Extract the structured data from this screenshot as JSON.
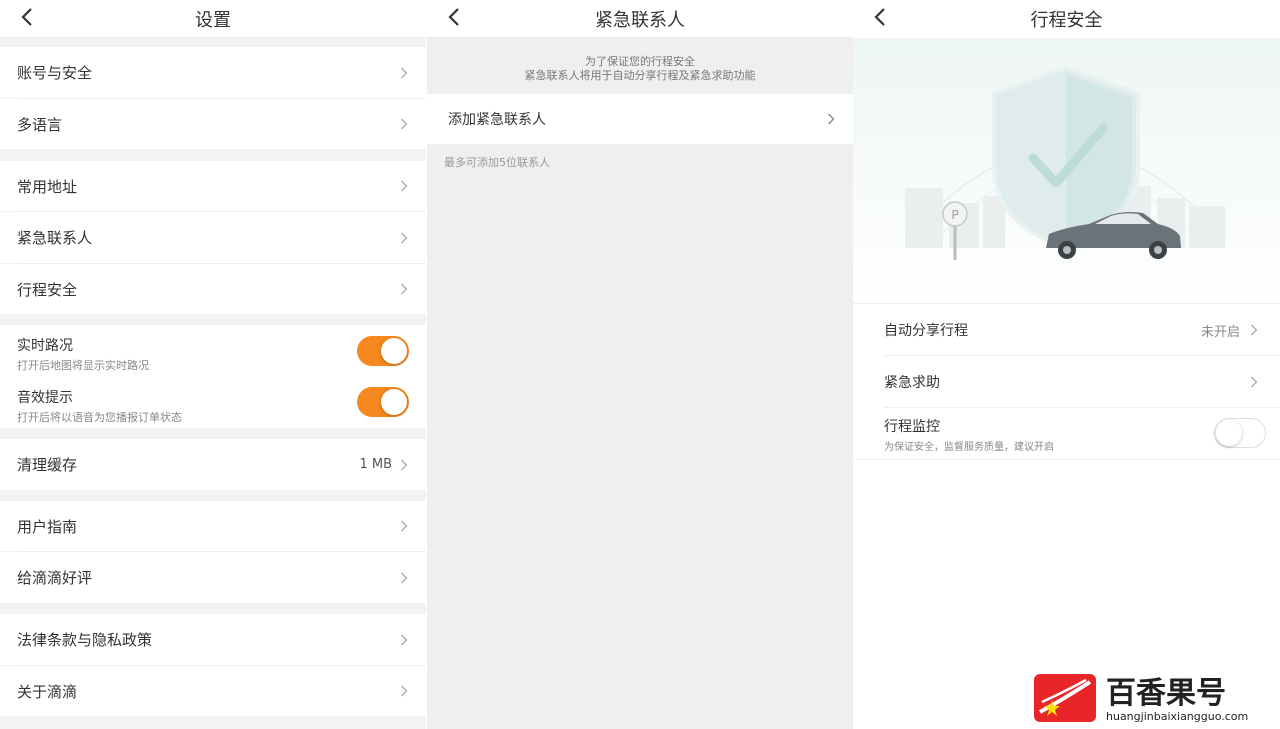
{
  "settings": {
    "title": "设置",
    "groups": [
      [
        {
          "label": "账号与安全"
        },
        {
          "label": "多语言"
        }
      ],
      [
        {
          "label": "常用地址"
        },
        {
          "label": "紧急联系人"
        },
        {
          "label": "行程安全"
        }
      ]
    ],
    "toggles": [
      {
        "title": "实时路况",
        "desc": "打开后地图将显示实时路况",
        "on": true
      },
      {
        "title": "音效提示",
        "desc": "打开后将以语音为您播报订单状态",
        "on": true
      }
    ],
    "cache": {
      "label": "清理缓存",
      "value": "1 MB"
    },
    "groups2": [
      [
        {
          "label": "用户指南"
        },
        {
          "label": "给滴滴好评"
        }
      ],
      [
        {
          "label": "法律条款与隐私政策"
        },
        {
          "label": "关于滴滴"
        }
      ]
    ]
  },
  "contacts": {
    "title": "紧急联系人",
    "notice_line1": "为了保证您的行程安全",
    "notice_line2": "紧急联系人将用于自动分享行程及紧急求助功能",
    "add_label": "添加紧急联系人",
    "hint": "最多可添加5位联系人"
  },
  "safety": {
    "title": "行程安全",
    "auto_share": {
      "label": "自动分享行程",
      "value": "未开启"
    },
    "sos": {
      "label": "紧急求助"
    },
    "monitor": {
      "title": "行程监控",
      "desc": "为保证安全，监督服务质量，建议开启",
      "on": false
    },
    "parking_sign": "P"
  },
  "watermark": {
    "name": "百香果号",
    "url": "huangjinbaixiangguo.com"
  },
  "colors": {
    "accent": "#f5881f",
    "watermark_red": "#e8262a"
  }
}
